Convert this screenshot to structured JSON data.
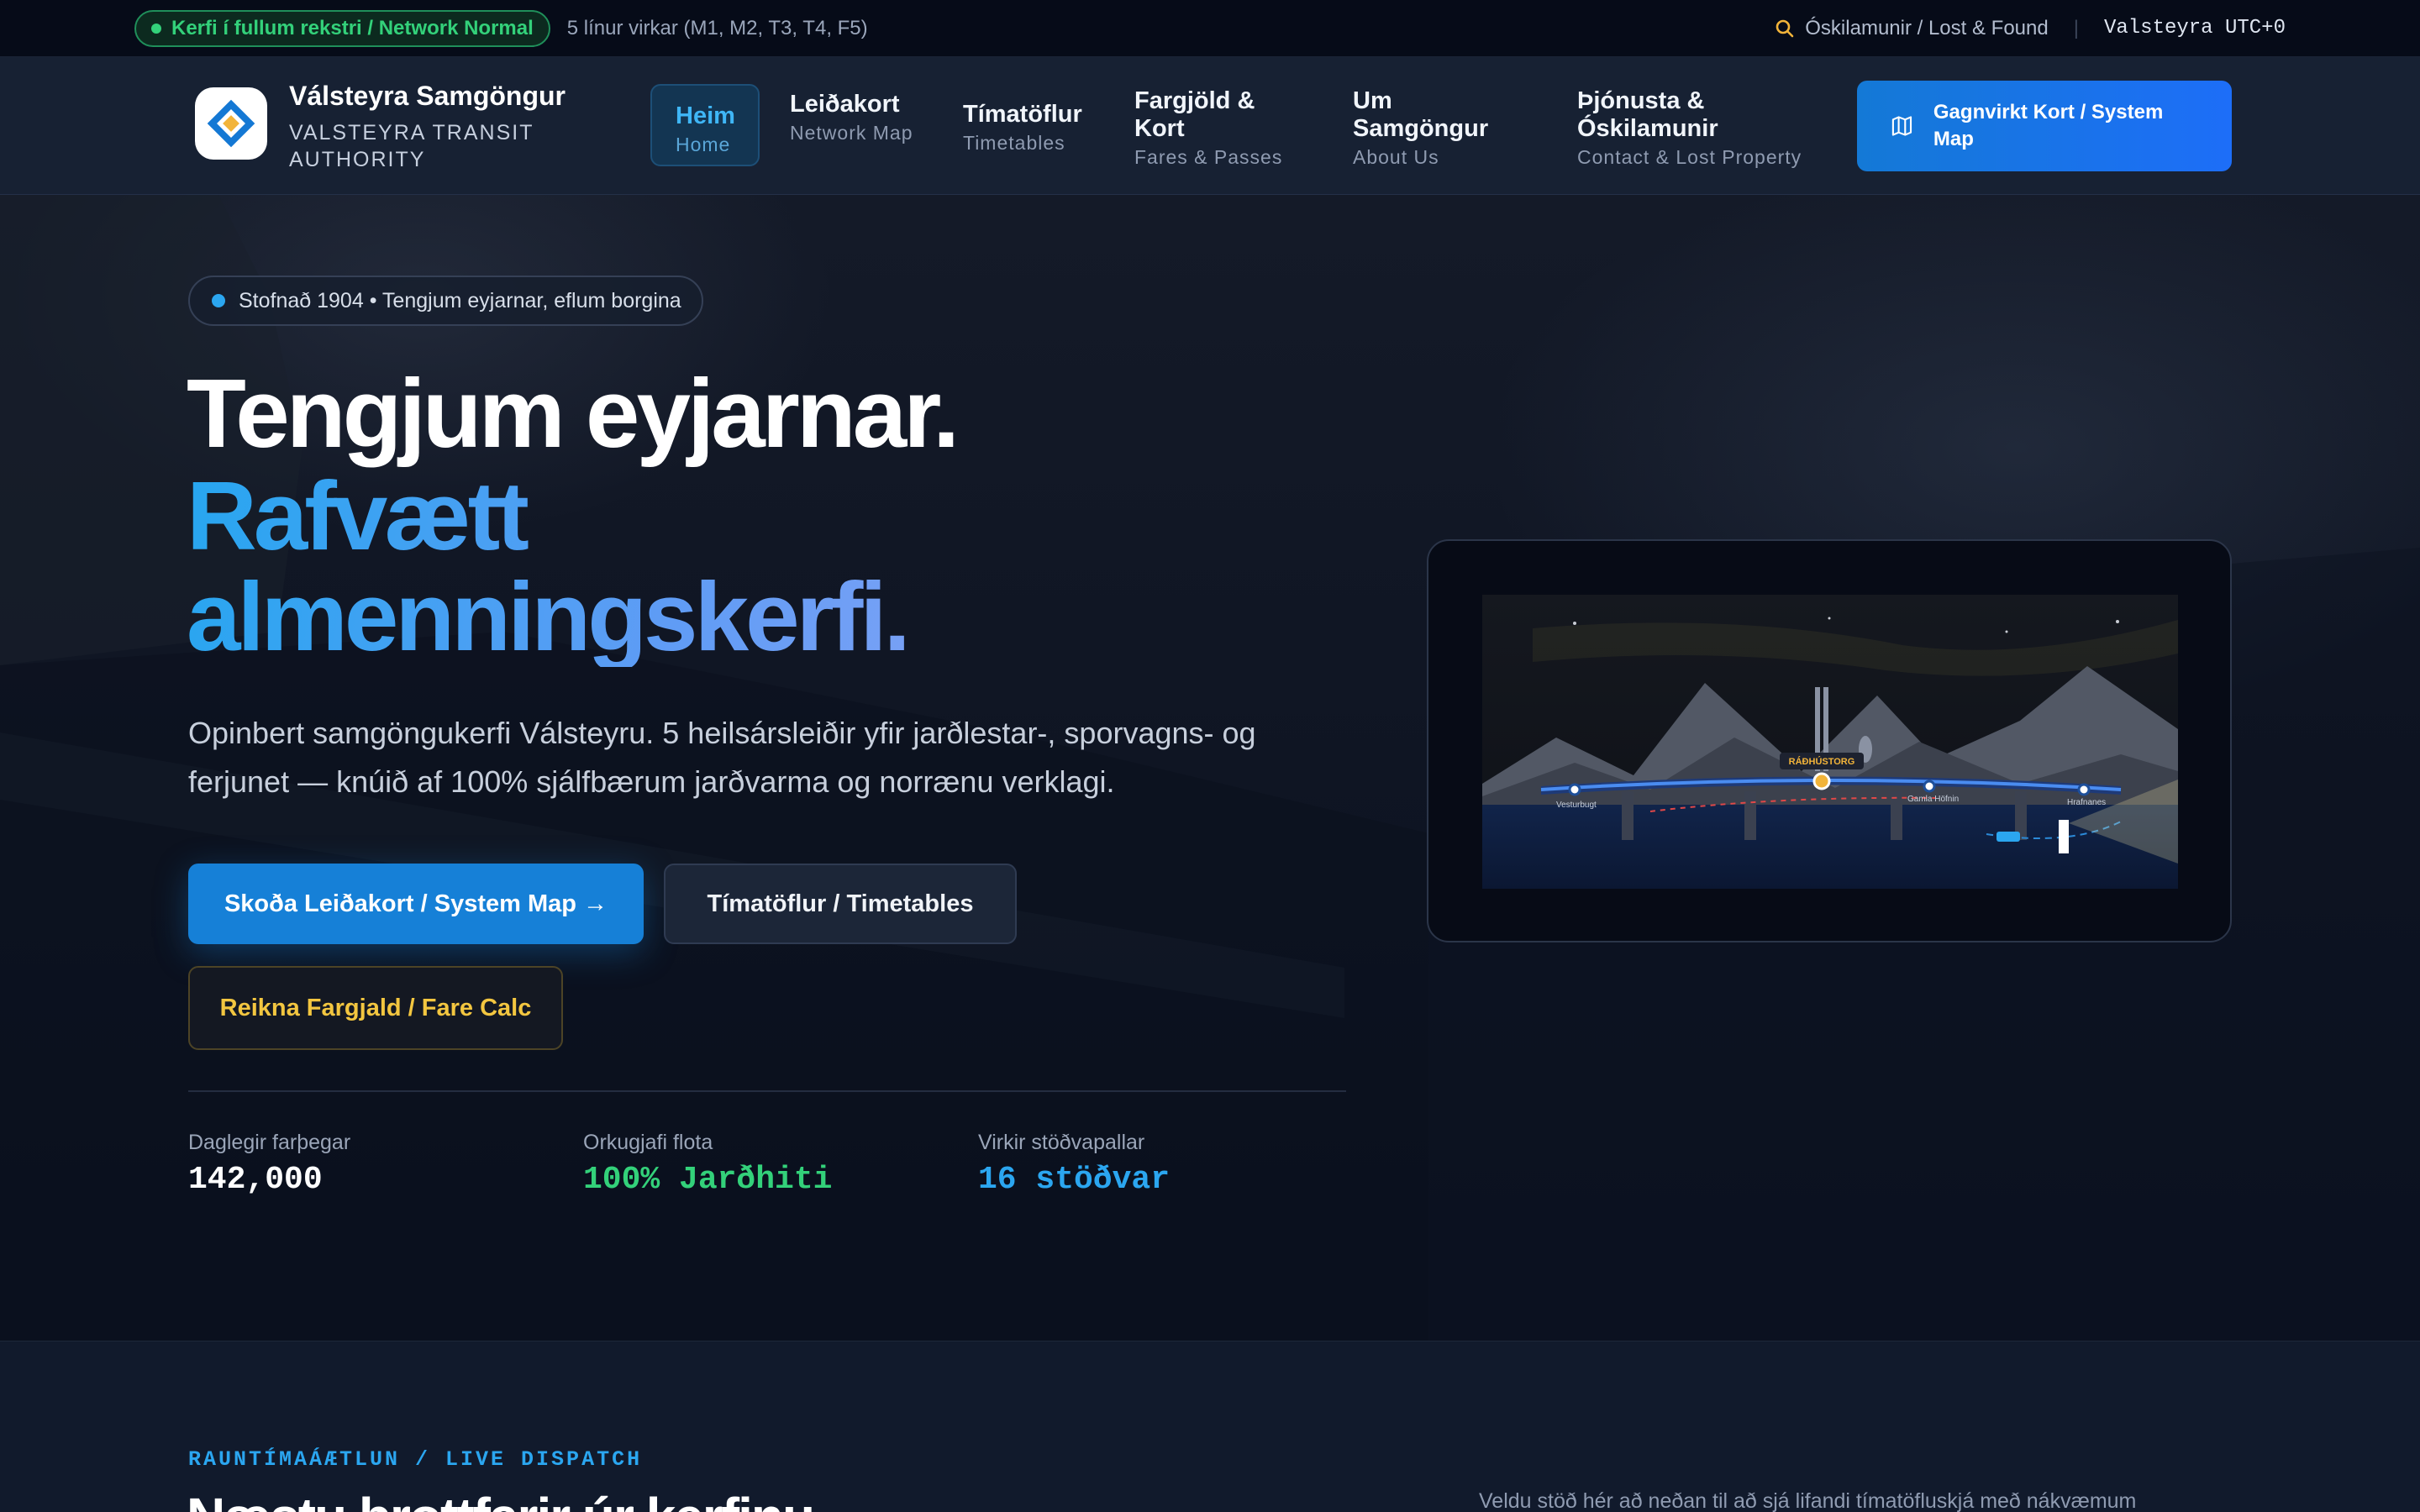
{
  "status_bar": {
    "network_status": "Kerfi í fullum rekstri / Network Normal",
    "active_lines": "5 línur virkar (M1, M2, T3, T4, F5)",
    "lost_found_link": "Óskilamunir / Lost & Found",
    "separator": "|",
    "timezone": "Valsteyra UTC+0",
    "status_color": "#33d17a"
  },
  "header": {
    "brand_name": "Válsteyra Samgöngur",
    "brand_sub": "VALSTEYRA TRANSIT AUTHORITY",
    "nav": [
      {
        "is": "Heim",
        "en": "Home",
        "active": true
      },
      {
        "is": "Leiðakort",
        "en": "Network Map"
      },
      {
        "is": "Tímatöflur",
        "en": "Timetables"
      },
      {
        "is": "Fargjöld & Kort",
        "en": "Fares & Passes"
      },
      {
        "is": "Um Samgöngur",
        "en": "About Us"
      },
      {
        "is": "Þjónusta & Óskilamunir",
        "en": "Contact & Lost Property"
      }
    ],
    "cta_label": "Gagnvirkt Kort / System Map",
    "cta_icon": "map-icon",
    "accent_color": "#1680d7"
  },
  "hero": {
    "badge": "Stofnað 1904 • Tengjum eyjarnar, eflum borgina",
    "headline_line1": "Tengjum eyjarnar.",
    "headline_line2": "Rafvætt",
    "headline_line3": "almenningskerfi.",
    "lead": "Opinbert samgöngukerfi Válsteyru. 5 heilsárs­leiðir yfir jarðlestar-, sporvagns- og ferjunet — knúið af 100% sjálfbærum jarðvarma og norrænu verklagi.",
    "btn_primary": "Skoða Leiðakort / System Map →",
    "btn_secondary": "Tímatöflur / Timetables",
    "btn_tertiary": "Reikna Fargjald / Fare Calc",
    "stats": [
      {
        "label": "Daglegir farþegar",
        "value": "142,000"
      },
      {
        "label": "Orkugjafi flota",
        "value": "100% Jarðhiti"
      },
      {
        "label": "Virkir stöðvapallar",
        "value": "16 stöðvar"
      }
    ],
    "map_illustration": {
      "hub_label": "RÁÐHÚSTORG",
      "stations": [
        "Vesturbugt",
        "Gamla Höfnin",
        "Hrafnanes"
      ]
    }
  },
  "section": {
    "eyebrow": "RAUNTÍMAÁÆTLUN / LIVE DISPATCH",
    "title": "Næstu brottfarir úr kerfinu",
    "description": "Veldu stöð hér að neðan til að sjá lifandi tímatöfluskjá með nákvæmum"
  }
}
